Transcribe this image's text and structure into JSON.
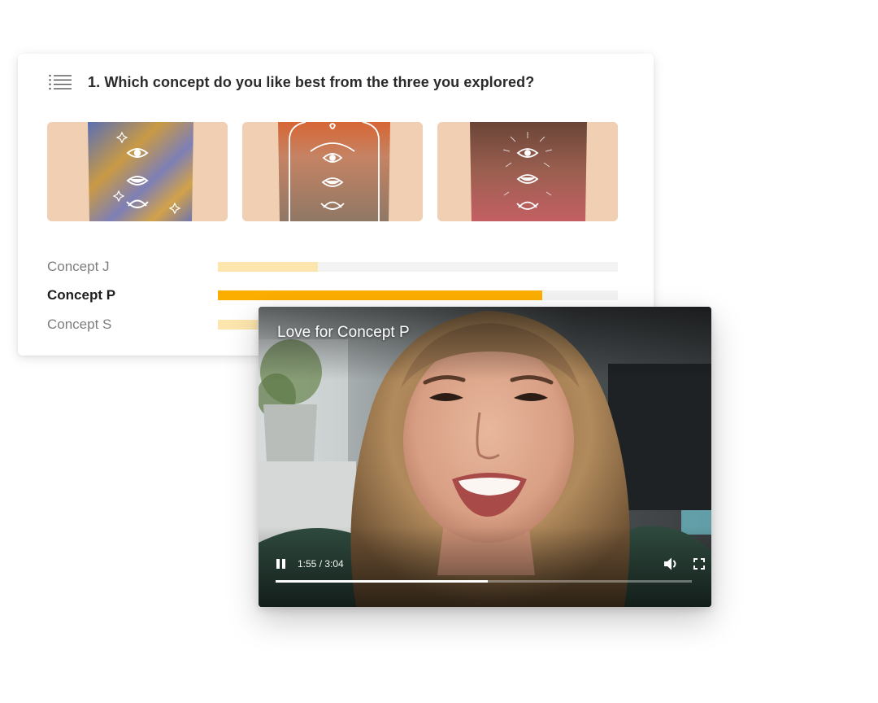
{
  "question": {
    "title": "1. Which concept do you like best from the three you explored?",
    "icon": "list-icon"
  },
  "concepts": [
    {
      "name": "Concept J",
      "share": 0.25,
      "highlighted": false,
      "palette": [
        "#6c78b6",
        "#c99a45"
      ]
    },
    {
      "name": "Concept P",
      "share": 0.81,
      "highlighted": true,
      "palette": [
        "#d36a3a",
        "#a07a62"
      ]
    },
    {
      "name": "Concept S",
      "share": 0.1,
      "highlighted": false,
      "palette": [
        "#6e4a3e",
        "#c25c60"
      ]
    }
  ],
  "colors": {
    "accent": "#fcae00",
    "accent_light": "#fde6ad",
    "track": "#f3f3f3",
    "image_background": "#f0cfb2"
  },
  "video": {
    "title": "Love for Concept P",
    "time": "1:55 / 3:04",
    "progress": 0.51,
    "state": "playing",
    "icons": {
      "pause": "pause-icon",
      "volume": "volume-icon",
      "fullscreen": "fullscreen-icon"
    }
  }
}
